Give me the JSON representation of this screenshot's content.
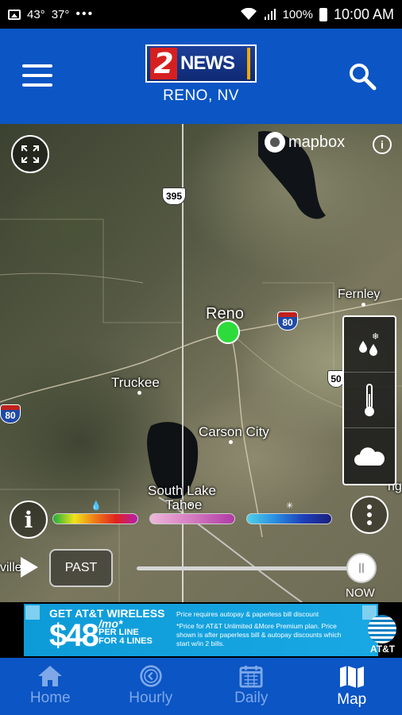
{
  "status_bar": {
    "temp1": "43°",
    "temp2": "37°",
    "more": "•••",
    "battery": "100%",
    "time": "10:00 AM"
  },
  "header": {
    "logo_number": "2",
    "logo_text": "NEWS",
    "location": "RENO, NV"
  },
  "map": {
    "attribution": "mapbox",
    "labels": {
      "reno": "Reno",
      "truckee": "Truckee",
      "carson_city": "Carson City",
      "south_lake_tahoe_line1": "South Lake",
      "south_lake_tahoe_line2": "Tahoe",
      "fernley": "Fernley",
      "partial_left": "ville",
      "partial_right": "ng"
    },
    "shields": {
      "us395": "395",
      "i80_east": "80",
      "i80_west": "80",
      "us50": "50"
    },
    "layers": [
      "winter-precip-icon",
      "thermometer-icon",
      "cloud-icon"
    ]
  },
  "legend": {
    "info_label": "i",
    "bars": [
      {
        "name": "rain",
        "colors": [
          "#1fae3a",
          "#f0e41a",
          "#ef7a17",
          "#e0221e",
          "#b51eb0"
        ]
      },
      {
        "name": "mix",
        "colors": [
          "#e9a9d2",
          "#d06bb8",
          "#b03aa6"
        ]
      },
      {
        "name": "snow",
        "colors": [
          "#4fd0e8",
          "#2a8ee0",
          "#1d3fb8",
          "#1c1f7d"
        ]
      }
    ]
  },
  "timeline": {
    "past_label": "PAST",
    "now_label": "NOW",
    "position": 1.0
  },
  "ad": {
    "headline": "GET AT&T WIRELESS",
    "price": "$48",
    "per_mo": "/mo*",
    "per_line": "PER LINE",
    "for_lines": "FOR 4 LINES",
    "fine1": "Price requires autopay & paperless bill discount",
    "fine2": "*Price for AT&T Unlimited &More Premium plan. Price shown is after paperless bill & autopay discounts which start w/in 2 bills.",
    "brand": "AT&T"
  },
  "nav": {
    "items": [
      {
        "label": "Home",
        "icon": "home-icon",
        "active": false
      },
      {
        "label": "Hourly",
        "icon": "clock-icon",
        "active": false
      },
      {
        "label": "Daily",
        "icon": "calendar-icon",
        "active": false
      },
      {
        "label": "Map",
        "icon": "map-icon",
        "active": true
      }
    ]
  },
  "colors": {
    "header_blue": "#0b55c4",
    "location_dot": "#2ddc3a",
    "nav_inactive": "#7ea8e8"
  }
}
